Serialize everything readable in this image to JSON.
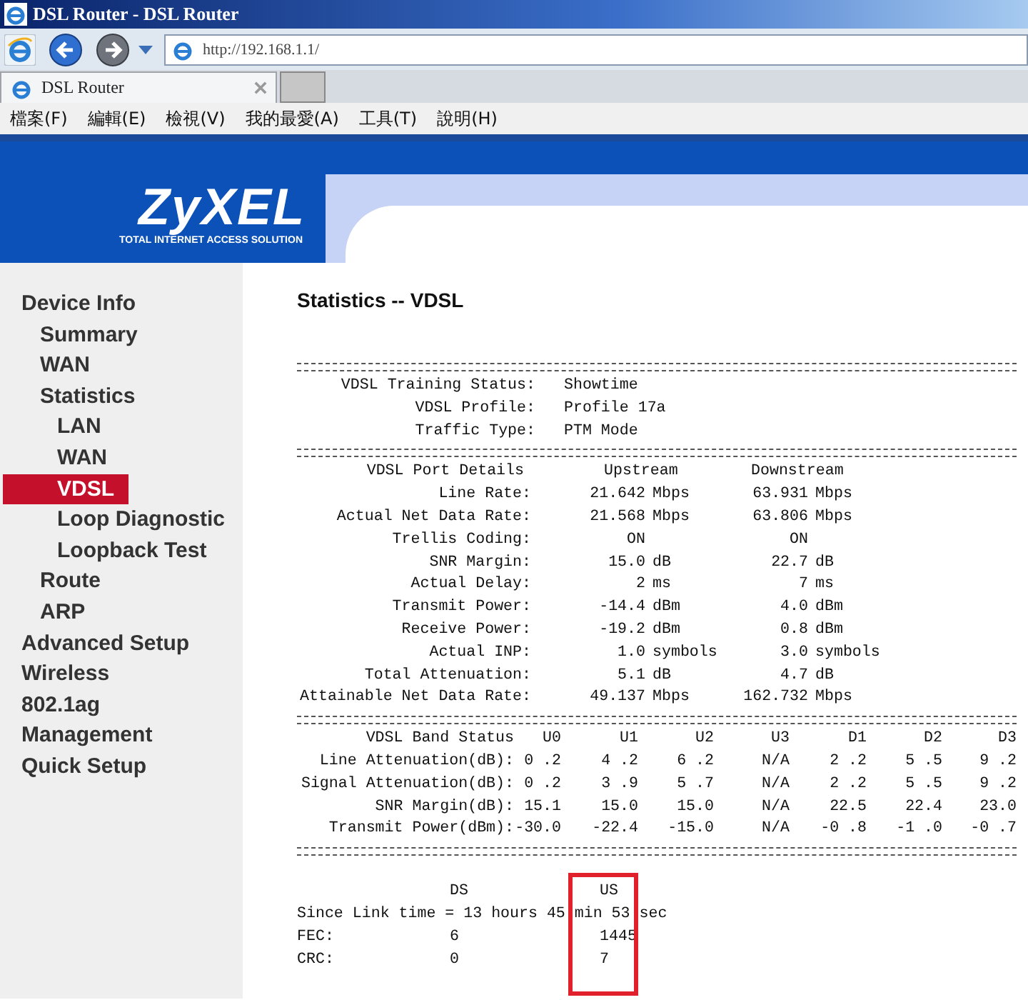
{
  "window": {
    "title": "DSL Router - DSL Router"
  },
  "address_bar": {
    "url": "http://192.168.1.1/"
  },
  "tabs": [
    {
      "label": "DSL Router",
      "selected": true
    }
  ],
  "menu": [
    "檔案(F)",
    "編輯(E)",
    "檢視(V)",
    "我的最愛(A)",
    "工具(T)",
    "說明(H)"
  ],
  "logo": {
    "wordmark": "ZyXEL",
    "tagline": "TOTAL INTERNET ACCESS SOLUTION"
  },
  "sidebar": {
    "items": [
      {
        "label": "Device Info",
        "selected": false,
        "children": [
          {
            "label": "Summary",
            "selected": false
          },
          {
            "label": "WAN",
            "selected": false
          },
          {
            "label": "Statistics",
            "selected": false,
            "children": [
              {
                "label": "LAN",
                "selected": false
              },
              {
                "label": "WAN",
                "selected": false
              },
              {
                "label": "VDSL",
                "selected": true
              },
              {
                "label": "Loop Diagnostic",
                "selected": false
              },
              {
                "label": "Loopback Test",
                "selected": false
              }
            ]
          },
          {
            "label": "Route",
            "selected": false
          },
          {
            "label": "ARP",
            "selected": false
          }
        ]
      },
      {
        "label": "Advanced Setup",
        "selected": false
      },
      {
        "label": "Wireless",
        "selected": false
      },
      {
        "label": "802.1ag",
        "selected": false
      },
      {
        "label": "Management",
        "selected": false
      },
      {
        "label": "Quick Setup",
        "selected": false
      }
    ]
  },
  "page_title": "Statistics -- VDSL",
  "status_rows": [
    {
      "label": "VDSL Training Status:",
      "value": "Showtime"
    },
    {
      "label": "VDSL Profile:",
      "value": "Profile 17a"
    },
    {
      "label": "Traffic Type:",
      "value": "PTM Mode"
    }
  ],
  "port_details": {
    "header": [
      "VDSL Port Details",
      "Upstream",
      "Downstream"
    ],
    "rows": [
      {
        "label": "Line Rate:",
        "up": "21.642",
        "up_unit": "Mbps",
        "down": "63.931",
        "down_unit": "Mbps"
      },
      {
        "label": "Actual Net Data Rate:",
        "up": "21.568",
        "up_unit": "Mbps",
        "down": "63.806",
        "down_unit": "Mbps"
      },
      {
        "label": "Trellis Coding:",
        "up": "ON",
        "down": "ON"
      },
      {
        "label": "SNR Margin:",
        "up": "15.0",
        "up_unit": "dB",
        "down": "22.7",
        "down_unit": "dB"
      },
      {
        "label": "Actual Delay:",
        "up": "2",
        "up_unit": "ms",
        "down": "7",
        "down_unit": "ms"
      },
      {
        "label": "Transmit Power:",
        "up": "-14.4",
        "up_unit": "dBm",
        "down": "4.0",
        "down_unit": "dBm"
      },
      {
        "label": "Receive Power:",
        "up": "-19.2",
        "up_unit": "dBm",
        "down": "0.8",
        "down_unit": "dBm"
      },
      {
        "label": "Actual INP:",
        "up": "1.0",
        "up_unit": "symbols",
        "down": "3.0",
        "down_unit": "symbols"
      },
      {
        "label": "Total Attenuation:",
        "up": "5.1",
        "up_unit": "dB",
        "down": "4.7",
        "down_unit": "dB"
      },
      {
        "label": "Attainable Net Data Rate:",
        "up": "49.137",
        "up_unit": "Mbps",
        "down": "162.732",
        "down_unit": "Mbps"
      }
    ]
  },
  "band_status": {
    "columns": [
      "VDSL Band Status",
      "U0",
      "U1",
      "U2",
      "U3",
      "D1",
      "D2",
      "D3"
    ],
    "rows": [
      {
        "label": "Line Attenuation(dB):",
        "values": [
          "0 .2",
          "4 .2",
          "6 .2",
          "N/A",
          "2 .2",
          "5 .5",
          "9 .2"
        ]
      },
      {
        "label": "Signal Attenuation(dB):",
        "values": [
          "0 .2",
          "3 .9",
          "5 .7",
          "N/A",
          "2 .2",
          "5 .5",
          "9 .2"
        ]
      },
      {
        "label": "SNR Margin(dB):",
        "values": [
          "15.1",
          "15.0",
          "15.0",
          "N/A",
          "22.5",
          "22.4",
          "23.0"
        ]
      },
      {
        "label": "Transmit Power(dBm):",
        "values": [
          "-30.0",
          "-22.4",
          "-15.0",
          "N/A",
          "-0 .8",
          "-1 .0",
          "-0 .7"
        ]
      }
    ]
  },
  "link_stats": {
    "columns": [
      "DS",
      "US"
    ],
    "since_link": "Since Link time = 13 hours 45 min 53 sec",
    "rows": [
      {
        "label": "FEC:",
        "values": [
          "6",
          "1445"
        ]
      },
      {
        "label": "CRC:",
        "values": [
          "0",
          "7"
        ]
      }
    ],
    "highlight_us": true
  }
}
